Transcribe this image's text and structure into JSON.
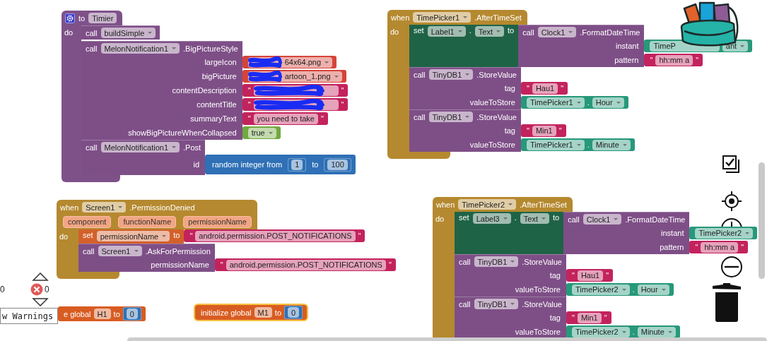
{
  "workspace": {
    "blocks": [
      {
        "kind": "procedure",
        "keyword": "to",
        "name": "Timier",
        "do": "do",
        "body": [
          {
            "kind": "call",
            "keyword": "call",
            "component": "buildSimple"
          },
          {
            "kind": "call",
            "keyword": "call",
            "component": "MelonNotification1",
            "method": ".BigPictureStyle",
            "args": [
              {
                "name": "largeIcon",
                "value": {
                  "kind": "asset",
                  "value": "64x64.png",
                  "redacted": true
                }
              },
              {
                "name": "bigPicture",
                "value": {
                  "kind": "asset",
                  "value": "artoon_1.png",
                  "redacted": true
                }
              },
              {
                "name": "contentDescription",
                "value": {
                  "kind": "text",
                  "open": "\"",
                  "close": "\"",
                  "redacted": true
                }
              },
              {
                "name": "contentTitle",
                "value": {
                  "kind": "text",
                  "open": "\"",
                  "close": "\"",
                  "redacted": true
                }
              },
              {
                "name": "summaryText",
                "value": {
                  "kind": "text",
                  "open": "\"",
                  "value": "you need to take",
                  "close": "\""
                }
              },
              {
                "name": "showBigPictureWhenCollapsed",
                "value": {
                  "kind": "bool",
                  "value": "true"
                }
              }
            ]
          },
          {
            "kind": "call",
            "keyword": "call",
            "component": "MelonNotification1",
            "method": ".Post",
            "args": [
              {
                "name": "id",
                "value": {
                  "kind": "random",
                  "label": "random integer from",
                  "from": {
                    "kind": "number",
                    "value": "1"
                  },
                  "to_label": "to",
                  "to": {
                    "kind": "number",
                    "value": "100"
                  }
                }
              }
            ]
          }
        ]
      },
      {
        "kind": "event",
        "keyword": "when",
        "component": "TimePicker1",
        "event": ".AfterTimeSet",
        "do": "do",
        "body": [
          {
            "kind": "set",
            "keyword": "set",
            "component": "Label1",
            "dot": ".",
            "property": "Text",
            "to": "to",
            "value": {
              "kind": "call",
              "keyword": "call",
              "component": "Clock1",
              "method": ".FormatDateTime",
              "args": [
                {
                  "name": "instant",
                  "value": {
                    "kind": "getter",
                    "component": "TimeP",
                    "property": "ant"
                  }
                },
                {
                  "name": "pattern",
                  "value": {
                    "kind": "text",
                    "open": "\"",
                    "value": "hh:mm a",
                    "close": "\""
                  }
                }
              ]
            }
          },
          {
            "kind": "call",
            "keyword": "call",
            "component": "TinyDB1",
            "method": ".StoreValue",
            "args": [
              {
                "name": "tag",
                "value": {
                  "kind": "text",
                  "open": "\"",
                  "value": "Hau1",
                  "close": "\""
                }
              },
              {
                "name": "valueToStore",
                "value": {
                  "kind": "getter",
                  "component": "TimePicker1",
                  "dot": ".",
                  "property": "Hour"
                }
              }
            ]
          },
          {
            "kind": "call",
            "keyword": "call",
            "component": "TinyDB1",
            "method": ".StoreValue",
            "args": [
              {
                "name": "tag",
                "value": {
                  "kind": "text",
                  "open": "\"",
                  "value": "Min1",
                  "close": "\""
                }
              },
              {
                "name": "valueToStore",
                "value": {
                  "kind": "getter",
                  "component": "TimePicker1",
                  "dot": ".",
                  "property": "Minute"
                }
              }
            ]
          }
        ]
      },
      {
        "kind": "event",
        "keyword": "when",
        "component": "Screen1",
        "event": ".PermissionDenied",
        "params": [
          "component",
          "functionName",
          "permissionName"
        ],
        "do": "do",
        "body": [
          {
            "kind": "set_var",
            "keyword": "set",
            "variable": "permissionName",
            "to": "to",
            "value": {
              "kind": "text",
              "open": "\"",
              "value": "android.permission.POST_NOTIFICATIONS",
              "close": "\""
            }
          },
          {
            "kind": "call",
            "keyword": "call",
            "component": "Screen1",
            "method": ".AskForPermission",
            "args": [
              {
                "name": "permissionName",
                "value": {
                  "kind": "text",
                  "open": "\"",
                  "value": "android.permission.POST_NOTIFICATIONS",
                  "close": "\""
                }
              }
            ]
          }
        ]
      },
      {
        "kind": "global",
        "label": "e global",
        "name": "H1",
        "to": "to",
        "value": {
          "kind": "number",
          "value": "0"
        },
        "selected": false
      },
      {
        "kind": "global",
        "label": "initialize global",
        "name": "M1",
        "to": "to",
        "value": {
          "kind": "number",
          "value": "0"
        },
        "selected": true
      },
      {
        "kind": "event",
        "keyword": "when",
        "component": "TimePicker2",
        "event": ".AfterTimeSet",
        "do": "do",
        "body": [
          {
            "kind": "set",
            "keyword": "set",
            "component": "Label3",
            "dot": ".",
            "property": "Text",
            "to": "to",
            "value": {
              "kind": "call",
              "keyword": "call",
              "component": "Clock1",
              "method": ".FormatDateTime",
              "args": [
                {
                  "name": "instant",
                  "value": {
                    "kind": "getter",
                    "component": "TimePicker2"
                  }
                },
                {
                  "name": "pattern",
                  "value": {
                    "kind": "text",
                    "open": "\"",
                    "value": "hh:mm a",
                    "close": "\""
                  }
                }
              ]
            }
          },
          {
            "kind": "call",
            "keyword": "call",
            "component": "TinyDB1",
            "method": ".StoreValue",
            "args": [
              {
                "name": "tag",
                "value": {
                  "kind": "text",
                  "open": "\"",
                  "value": "Hau1",
                  "close": "\""
                }
              },
              {
                "name": "valueToStore",
                "value": {
                  "kind": "getter",
                  "component": "TimePicker2",
                  "dot": ".",
                  "property": "Hour"
                }
              }
            ]
          },
          {
            "kind": "call",
            "keyword": "call",
            "component": "TinyDB1",
            "method": ".StoreValue",
            "args": [
              {
                "name": "tag",
                "value": {
                  "kind": "text",
                  "open": "\"",
                  "value": "Min1",
                  "close": "\""
                }
              },
              {
                "name": "valueToStore",
                "value": {
                  "kind": "getter",
                  "component": "TimePicker2",
                  "dot": ".",
                  "property": "Minute"
                }
              }
            ]
          }
        ]
      }
    ]
  },
  "warnings": {
    "warning_count": "0",
    "error_count": "0",
    "button": "w Warnings"
  }
}
